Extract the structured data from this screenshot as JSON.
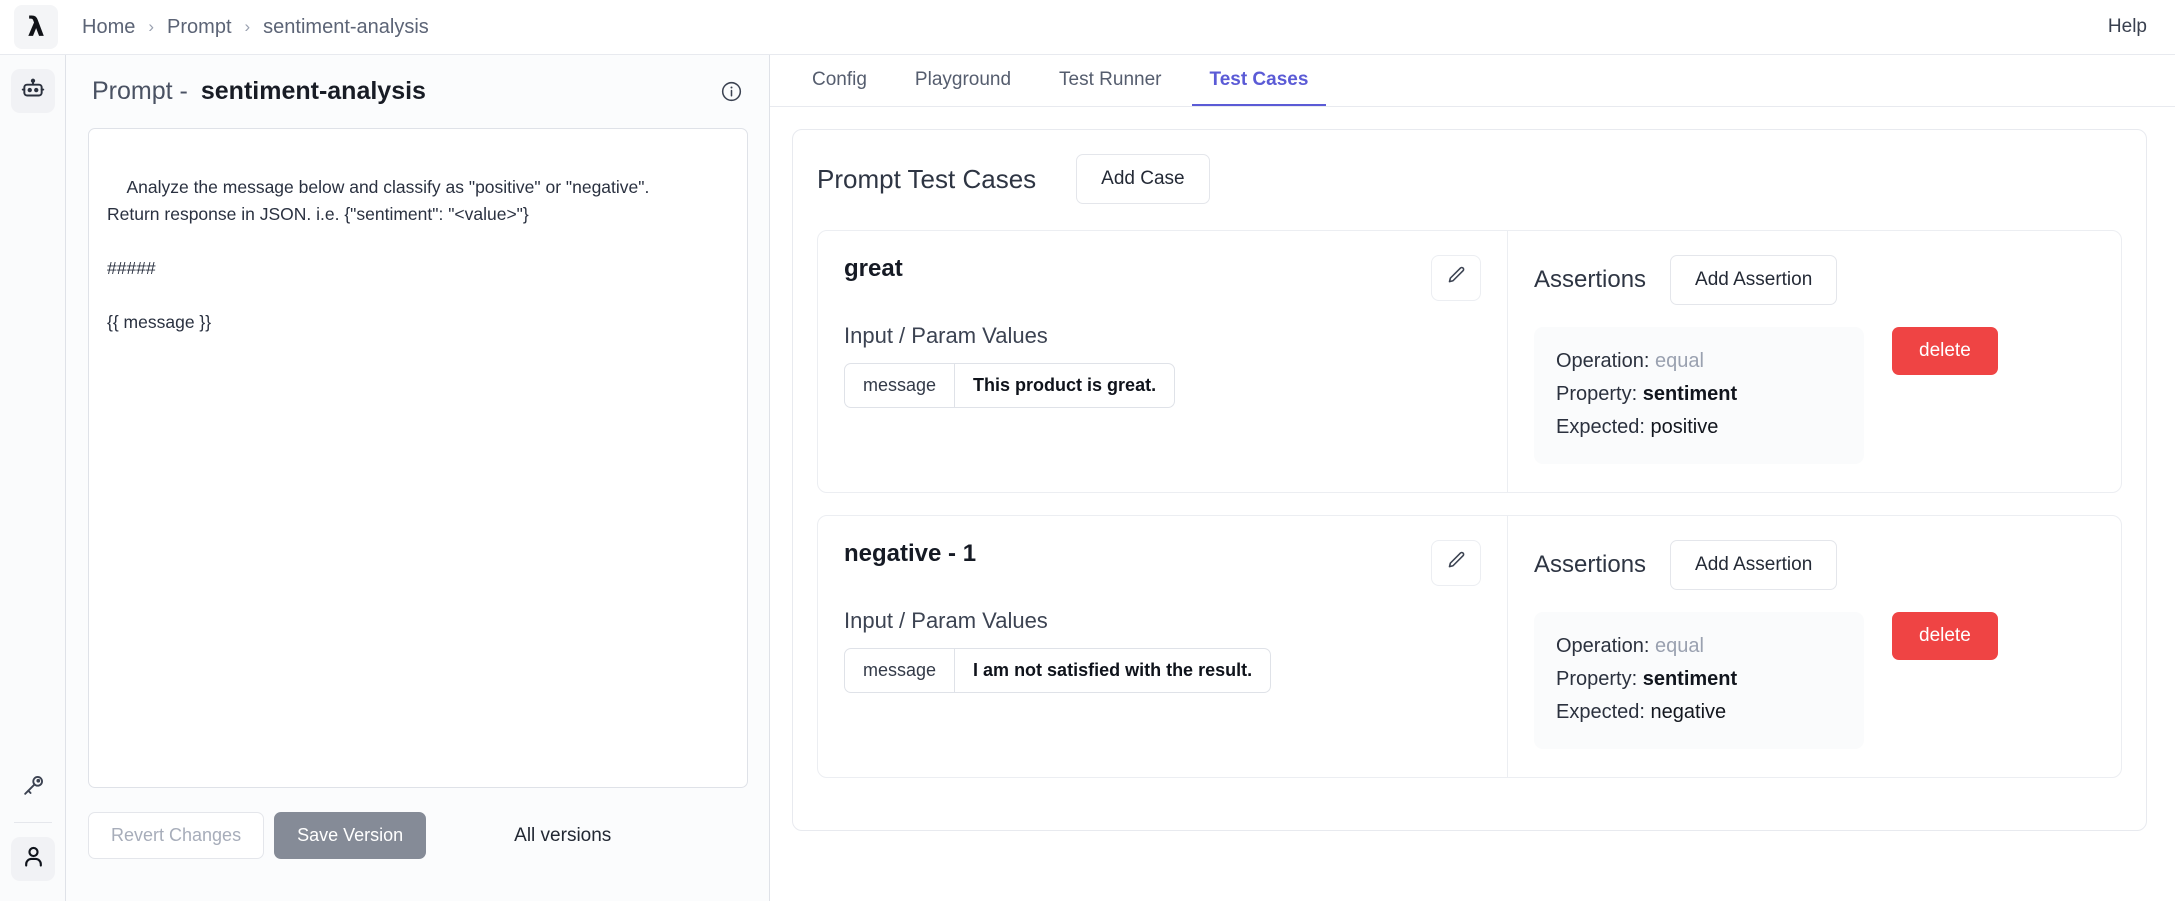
{
  "topbar": {
    "logo": "logo-lambda-icon",
    "logo_glyph": "λ",
    "breadcrumb": [
      "Home",
      "Prompt",
      "sentiment-analysis"
    ],
    "separator": "›",
    "help_label": "Help"
  },
  "rail": {
    "items": [
      {
        "name": "chatbot-icon",
        "active": true
      },
      {
        "name": "key-icon",
        "active": false
      },
      {
        "name": "user-account-icon",
        "active": true
      }
    ]
  },
  "prompt_panel": {
    "label": "Prompt -",
    "name": "sentiment-analysis",
    "info_icon": "info-icon",
    "textarea_value": "Analyze the message below and classify as \"positive\" or \"negative\".\nReturn response in JSON. i.e. {\"sentiment\": \"<value>\"}\n\n#####\n\n{{ message }}",
    "textarea_placeholder": "",
    "revert_label": "Revert Changes",
    "save_label": "Save Version",
    "all_versions_label": "All versions"
  },
  "tabs": [
    {
      "label": "Config",
      "active": false
    },
    {
      "label": "Playground",
      "active": false
    },
    {
      "label": "Test Runner",
      "active": false
    },
    {
      "label": "Test Cases",
      "active": true
    }
  ],
  "main": {
    "title": "Prompt Test Cases",
    "add_case_label": "Add Case",
    "assertions_title": "Assertions",
    "add_assertion_label": "Add Assertion",
    "delete_label": "delete",
    "input_section_label": "Input / Param Values",
    "operation_label": "Operation:",
    "property_label": "Property:",
    "expected_label": "Expected:",
    "cases": [
      {
        "title": "great",
        "params": [
          {
            "key": "message",
            "value": "This product is great."
          }
        ],
        "assertions": [
          {
            "operation": "equal",
            "property": "sentiment",
            "expected": "positive"
          }
        ]
      },
      {
        "title": "negative - 1",
        "params": [
          {
            "key": "message",
            "value": "I am not satisfied with the result."
          }
        ],
        "assertions": [
          {
            "operation": "equal",
            "property": "sentiment",
            "expected": "negative"
          }
        ]
      }
    ]
  },
  "colors": {
    "accent": "#5b5bd6",
    "danger": "#ef4444",
    "save_button": "#858b97",
    "border": "#e8eaef",
    "panel_bg": "#fbfcfd"
  }
}
